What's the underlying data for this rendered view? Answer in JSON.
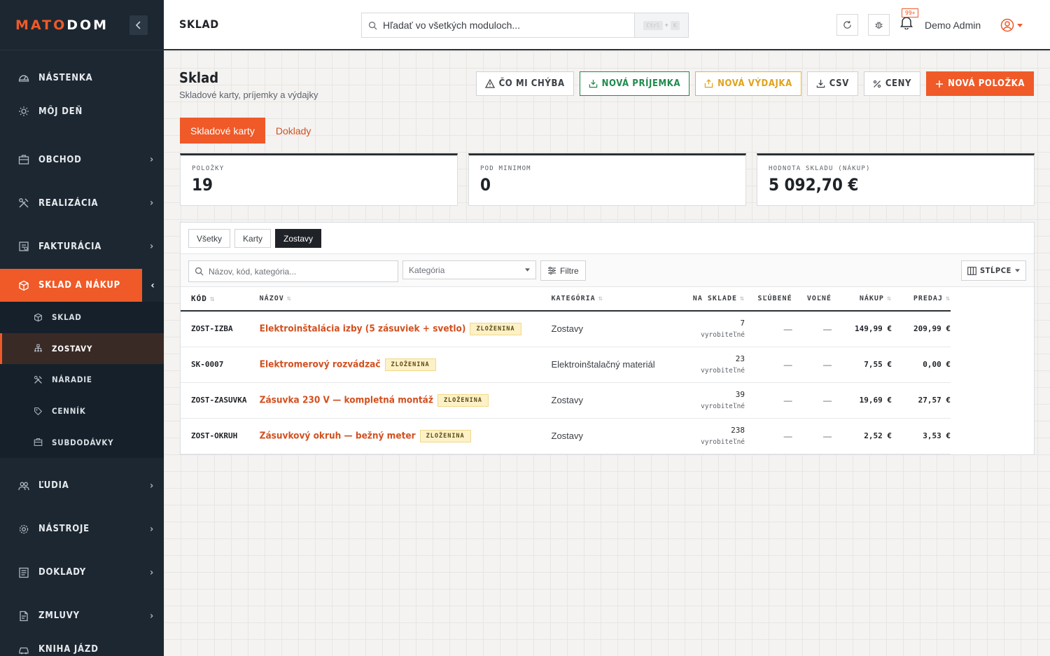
{
  "brand": {
    "logo_part1": "MATO",
    "logo_part2": "DOM"
  },
  "sidebar": {
    "items": [
      {
        "id": "nastenka",
        "label": "NÁSTENKA",
        "icon": "dashboard-icon",
        "has_children": false
      },
      {
        "id": "moj-den",
        "label": "MÔJ DEŇ",
        "icon": "sun-icon",
        "has_children": false
      },
      {
        "id": "obchod",
        "label": "OBCHOD",
        "icon": "briefcase-icon",
        "has_children": true
      },
      {
        "id": "realizacia",
        "label": "REALIZÁCIA",
        "icon": "tools-icon",
        "has_children": true
      },
      {
        "id": "fakturacia",
        "label": "FAKTURÁCIA",
        "icon": "invoice-icon",
        "has_children": true
      },
      {
        "id": "sklad-nakup",
        "label": "SKLAD A NÁKUP",
        "icon": "box-icon",
        "has_children": true,
        "active": true
      }
    ],
    "subitems": [
      {
        "id": "sklad",
        "label": "SKLAD",
        "icon": "box-icon"
      },
      {
        "id": "zostavy",
        "label": "ZOSTAVY",
        "icon": "hierarchy-icon",
        "active": true
      },
      {
        "id": "naradie",
        "label": "NÁRADIE",
        "icon": "tools-icon"
      },
      {
        "id": "cennik",
        "label": "CENNÍK",
        "icon": "tag-icon"
      },
      {
        "id": "subdodavky",
        "label": "SUBDODÁVKY",
        "icon": "briefcase-icon"
      }
    ],
    "items_after": [
      {
        "id": "ludia",
        "label": "ĽUDIA",
        "icon": "users-icon",
        "has_children": true
      },
      {
        "id": "nastroje",
        "label": "NÁSTROJE",
        "icon": "gear-icon",
        "has_children": true
      },
      {
        "id": "doklady",
        "label": "DOKLADY",
        "icon": "document-icon",
        "has_children": true
      },
      {
        "id": "zmluvy",
        "label": "ZMLUVY",
        "icon": "contract-icon",
        "has_children": true
      },
      {
        "id": "kniha-jazd",
        "label": "KNIHA JÁZD",
        "icon": "car-icon",
        "has_children": false
      }
    ]
  },
  "header": {
    "title": "SKLAD",
    "search_placeholder": "Hľadať vo všetkých moduloch...",
    "shortcut_key1": "Ctrl",
    "shortcut_plus": "+",
    "shortcut_key2": "K",
    "notifications_badge": "99+",
    "user_name": "Demo Admin"
  },
  "page": {
    "title": "Sklad",
    "subtitle": "Skladové karty, príjemky a výdajky",
    "actions": {
      "co_mi_chyba": "ČO MI CHÝBA",
      "nova_prijemka": "NOVÁ PRÍJEMKA",
      "nova_vydajka": "NOVÁ VÝDAJKA",
      "csv": "CSV",
      "ceny": "CENY",
      "nova_polozka": "NOVÁ POLOŽKA"
    },
    "tabs": {
      "karty": "Skladové karty",
      "doklady": "Doklady"
    }
  },
  "stats": {
    "polozky_label": "POLOŽKY",
    "polozky_value": "19",
    "pod_minimom_label": "POD MINIMOM",
    "pod_minimom_value": "0",
    "hodnota_label": "HODNOTA SKLADU (NÁKUP)",
    "hodnota_value": "5 092,70 €"
  },
  "filters": {
    "seg_vsetky": "Všetky",
    "seg_karty": "Karty",
    "seg_zostavy": "Zostavy",
    "search_placeholder": "Názov, kód, kategória...",
    "category_placeholder": "Kategória",
    "filter_label": "Filtre",
    "columns_label": "STĹPCE"
  },
  "table": {
    "headers": {
      "kod": "KÓD",
      "nazov": "NÁZOV",
      "kategoria": "KATEGÓRIA",
      "na_sklade": "NA SKLADE",
      "zlubene": "SĽÚBENÉ",
      "volne": "VOĽNÉ",
      "nakup": "NÁKUP",
      "predaj": "PREDAJ"
    },
    "rows": [
      {
        "code": "ZOST-IZBA",
        "name": "Elektroinštalácia izby (5 zásuviek + svetlo)",
        "tag": "ZLOŽENINA",
        "category": "Zostavy",
        "stock": "7",
        "stock_sub": "vyrobiteľné",
        "promised": "—",
        "free": "—",
        "buy": "149,99 €",
        "sell": "209,99 €"
      },
      {
        "code": "SK-0007",
        "name": "Elektromerový rozvádzač",
        "tag": "ZLOŽENINA",
        "category": "Elektroinštalačný materiál",
        "stock": "23",
        "stock_sub": "vyrobiteľné",
        "promised": "—",
        "free": "—",
        "buy": "7,55 €",
        "sell": "0,00 €"
      },
      {
        "code": "ZOST-ZASUVKA",
        "name": "Zásuvka 230 V — kompletná montáž",
        "tag": "ZLOŽENINA",
        "category": "Zostavy",
        "stock": "39",
        "stock_sub": "vyrobiteľné",
        "promised": "—",
        "free": "—",
        "buy": "19,69 €",
        "sell": "27,57 €"
      },
      {
        "code": "ZOST-OKRUH",
        "name": "Zásuvkový okruh — bežný meter",
        "tag": "ZLOŽENINA",
        "category": "Zostavy",
        "stock": "238",
        "stock_sub": "vyrobiteľné",
        "promised": "—",
        "free": "—",
        "buy": "2,52 €",
        "sell": "3,53 €"
      }
    ]
  },
  "colors": {
    "accent": "#ef5a28",
    "sidebar_bg": "#1d2731",
    "success": "#1f8a4c",
    "warning": "#f0b429"
  }
}
